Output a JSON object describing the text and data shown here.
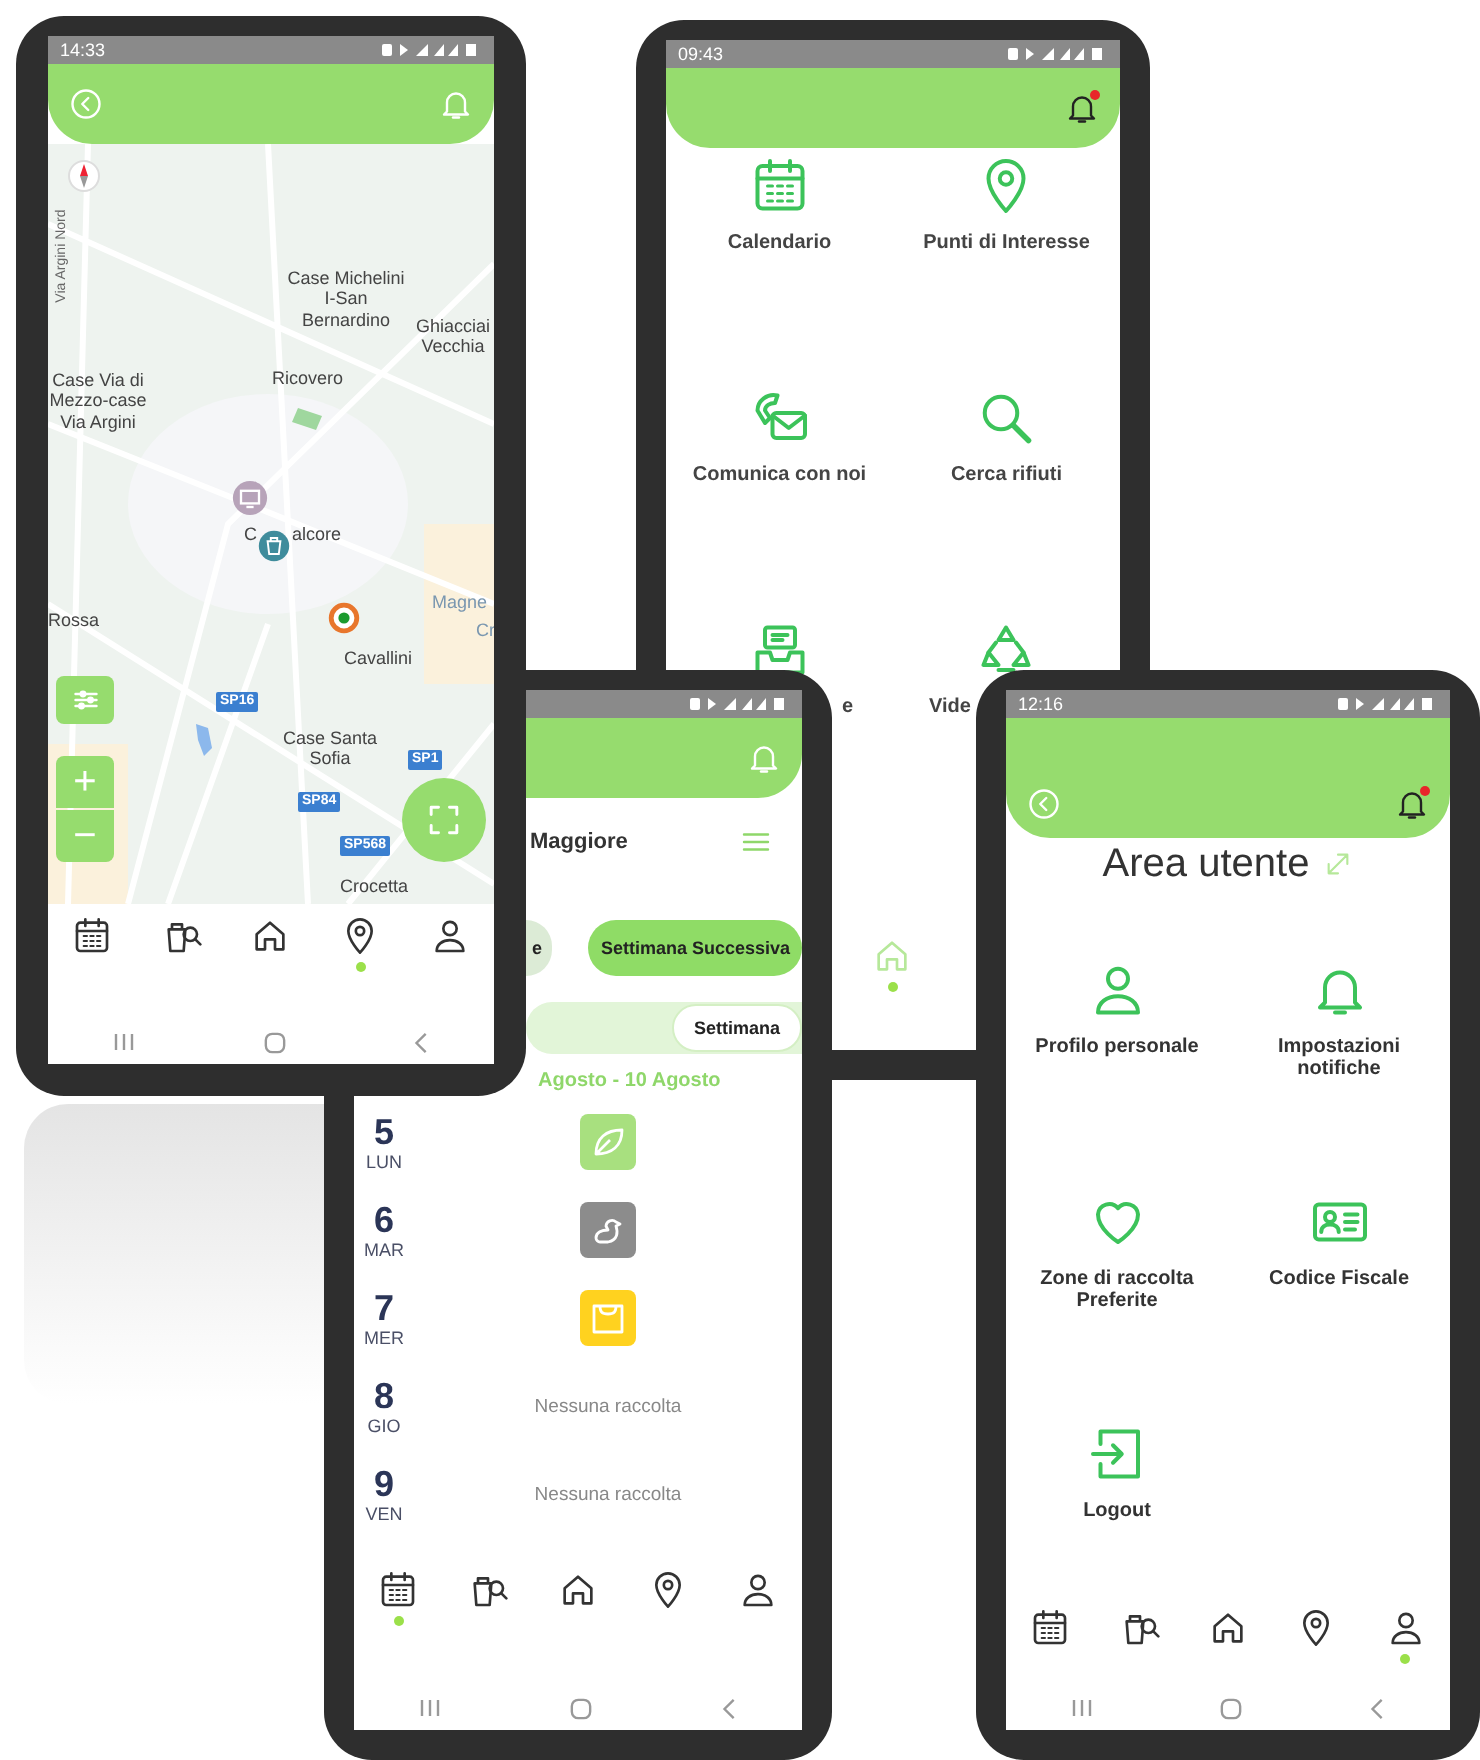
{
  "map_screen": {
    "status_bar": {
      "time": "14:33"
    },
    "header": {
      "unread": false
    },
    "map": {
      "labels": [
        {
          "text": "Via Argini Nord"
        },
        {
          "text": "Case Michelini I-San Bernardino"
        },
        {
          "text": "Ghiacciai Vecchia"
        },
        {
          "text": "Case Via di Mezzo-case Via Argini"
        },
        {
          "text": "Ricovero"
        },
        {
          "text": "C"
        },
        {
          "text": "alcore"
        },
        {
          "text": "Rossa"
        },
        {
          "text": "Magne"
        },
        {
          "text": "Cr"
        },
        {
          "text": "Cavallini"
        },
        {
          "text": "Case Santa Sofia"
        },
        {
          "text": "Crocetta"
        }
      ],
      "road_shields": [
        "SP16",
        "SP1",
        "SP84",
        "SP568"
      ],
      "markers": [
        {
          "kind": "monitor",
          "color": "#b7a3b9"
        },
        {
          "kind": "bin",
          "color": "#3f8c9c"
        },
        {
          "kind": "target",
          "color": "#e8762c"
        }
      ],
      "zoom_in": "+",
      "zoom_out": "−"
    },
    "nav": [
      {
        "kind": "calendar",
        "selected": false
      },
      {
        "kind": "binsearch",
        "selected": false
      },
      {
        "kind": "home",
        "selected": false
      },
      {
        "kind": "pin",
        "selected": true
      },
      {
        "kind": "user",
        "selected": false
      }
    ]
  },
  "menu_screen": {
    "status_bar": {
      "time": "09:43"
    },
    "header": {
      "unread": true
    },
    "items": [
      {
        "kind": "calendar",
        "label": "Calendario"
      },
      {
        "kind": "pin",
        "label": "Punti di Interesse"
      },
      {
        "kind": "phonemail",
        "label": "Comunica con noi"
      },
      {
        "kind": "magnifier",
        "label": "Cerca rifiuti"
      },
      {
        "kind": "tray",
        "label": "e"
      },
      {
        "kind": "recycle",
        "label": "Vide"
      }
    ],
    "nav": [
      {
        "kind": "home",
        "selected": true
      }
    ]
  },
  "calendar_screen": {
    "header": {
      "unread": false
    },
    "title": "Maggiore",
    "week_buttons": [
      {
        "label": "e",
        "selected": false
      },
      {
        "label": "Settimana Successiva",
        "selected": true
      }
    ],
    "view_toggle": [
      {
        "label": "Settimana",
        "selected": true
      }
    ],
    "date_range": "Agosto - 10 Agosto",
    "days": [
      {
        "day": "5",
        "weekday": "LUN",
        "kind": "leaf",
        "color": "#a8e07f"
      },
      {
        "day": "6",
        "weekday": "MAR",
        "kind": "duck",
        "color": "#8c8c8c"
      },
      {
        "day": "7",
        "weekday": "MER",
        "kind": "bag",
        "color": "#ffd21f"
      },
      {
        "day": "8",
        "weekday": "GIO",
        "kind": "none",
        "text": "Nessuna raccolta"
      },
      {
        "day": "9",
        "weekday": "VEN",
        "kind": "none",
        "text": "Nessuna raccolta"
      }
    ],
    "nav": [
      {
        "kind": "calendar",
        "selected": true
      },
      {
        "kind": "binsearch",
        "selected": false
      },
      {
        "kind": "home",
        "selected": false
      },
      {
        "kind": "pin",
        "selected": false
      },
      {
        "kind": "user",
        "selected": false
      }
    ]
  },
  "profile_screen": {
    "status_bar": {
      "time": "12:16"
    },
    "header": {
      "unread": true
    },
    "title": "Area utente",
    "items": [
      {
        "kind": "user",
        "label": "Profilo personale"
      },
      {
        "kind": "bell",
        "label": "Impostazioni notifiche"
      },
      {
        "kind": "heart",
        "label": "Zone di raccolta Preferite"
      },
      {
        "kind": "idcard",
        "label": "Codice Fiscale"
      },
      {
        "kind": "logout",
        "label": "Logout"
      }
    ],
    "nav": [
      {
        "kind": "calendar",
        "selected": false
      },
      {
        "kind": "binsearch",
        "selected": false
      },
      {
        "kind": "home",
        "selected": false
      },
      {
        "kind": "pin",
        "selected": false
      },
      {
        "kind": "user",
        "selected": true
      }
    ]
  }
}
